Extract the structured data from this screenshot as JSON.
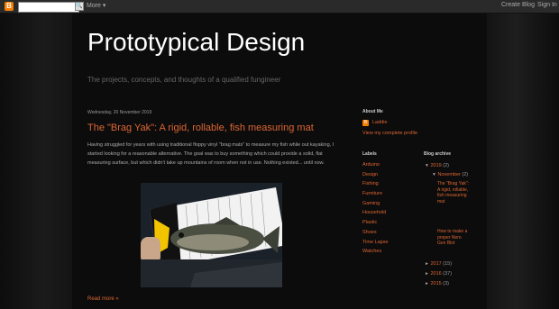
{
  "navbar": {
    "search_placeholder": "",
    "search_button_glyph": "🔍",
    "more_label": "More ▾",
    "create_blog_label": "Create Blog",
    "sign_in_label": "Sign In"
  },
  "blog": {
    "title": "Prototypical Design",
    "description": "The projects, concepts, and thoughts of a qualified fungineer"
  },
  "post": {
    "date": "Wednesday, 20 November 2019",
    "title": "The \"Brag Yak\": A rigid, rollable, fish measuring mat",
    "body": "Having struggled for years with using traditional floppy vinyl \"brag mats\" to measure my fish while out kayaking, I started looking for a reasonable alternative. The goal was to buy something which could provide a solid, flat measuring surface, but which didn't take up mountains of room when not in use. Nothing existed... until now.",
    "read_more": "Read more »"
  },
  "sidebar": {
    "about_heading": "About Me",
    "about_name": "Laddie",
    "profile_link": "View my complete profile",
    "labels_heading": "Labels",
    "labels": [
      "Arduino",
      "Design",
      "Fishing",
      "Furniture",
      "Gaming",
      "Household",
      "Plastic",
      "Shoes",
      "Time Lapse",
      "Watches"
    ],
    "archive_heading": "Blog archive",
    "archive": {
      "y2019": {
        "toggle": "▼",
        "label": "2019",
        "count": "(2)"
      },
      "nov": {
        "toggle": "▼",
        "label": "November",
        "count": "(2)"
      },
      "posts": [
        "The \"Brag Yak\": A rigid, rollable, fish measuring mat",
        "How to make a proper Nero Gen Blot"
      ],
      "y2017": {
        "toggle": "►",
        "label": "2017",
        "count": "(15)"
      },
      "y2016": {
        "toggle": "►",
        "label": "2016",
        "count": "(37)"
      },
      "y2015": {
        "toggle": "►",
        "label": "2015",
        "count": "(3)"
      }
    }
  },
  "colors": {
    "accent": "#dd6633",
    "brand": "#f57d00"
  }
}
